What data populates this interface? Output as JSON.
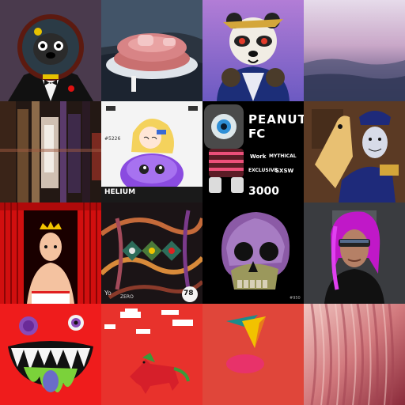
{
  "tiles": {
    "helium": {
      "name": "HELIUM",
      "id": "#5226"
    },
    "peanut": {
      "title_line1": "PEANUT",
      "title_line2": "FC",
      "badge_left": "Work",
      "badge_right": "MYTHICAL",
      "exclusive": "EXCLUSIVE",
      "sxsw": "SXSW",
      "number": "3000"
    },
    "rings": {
      "brand": "Yo",
      "sub": "ZERO",
      "count": "78"
    },
    "skull": {
      "id": "#950"
    }
  },
  "colors": {
    "bg_dark": "#111111",
    "red": "#e02020",
    "salmon": "#e0463a"
  }
}
